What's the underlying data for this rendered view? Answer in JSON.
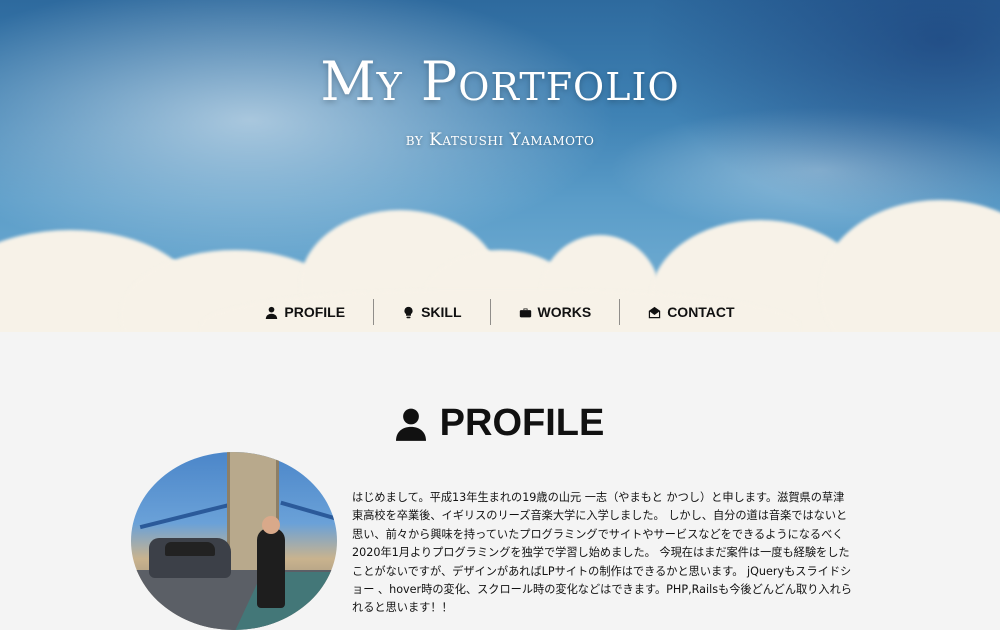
{
  "hero": {
    "title": "My Portfolio",
    "subtitle": "by Katsushi Yamamoto"
  },
  "nav": {
    "items": [
      {
        "label": "PROFILE",
        "icon": "person-icon"
      },
      {
        "label": "SKILL",
        "icon": "lightbulb-icon"
      },
      {
        "label": "WORKS",
        "icon": "briefcase-icon"
      },
      {
        "label": "CONTACT",
        "icon": "envelope-open-icon"
      }
    ]
  },
  "profile": {
    "heading": "PROFILE",
    "heading_icon": "person-icon",
    "photo_alt": "profile photo on Tower Bridge",
    "bio": "はじめまして。平成13年生まれの19歳の山元 一志（やまもと かつし）と申します。滋賀県の草津東高校を卒業後、イギリスのリーズ音楽大学に入学しました。 しかし、自分の道は音楽ではないと思い、前々から興味を持っていたプログラミングでサイトやサービスなどをできるようになるべく2020年1月よりプログラミングを独学で学習し始めました。 今現在はまだ案件は一度も経験をしたことがないですが、デザインがあればLPサイトの制作はできるかと思います。 jQueryもスライドショー 、hover時の変化、スクロール時の変化などはできます。PHP,Railsも今後どんどん取り入れられると思います！！"
  },
  "colors": {
    "page_bg": "#f4f4f4",
    "text": "#111111",
    "hero_text": "#ffffff"
  }
}
